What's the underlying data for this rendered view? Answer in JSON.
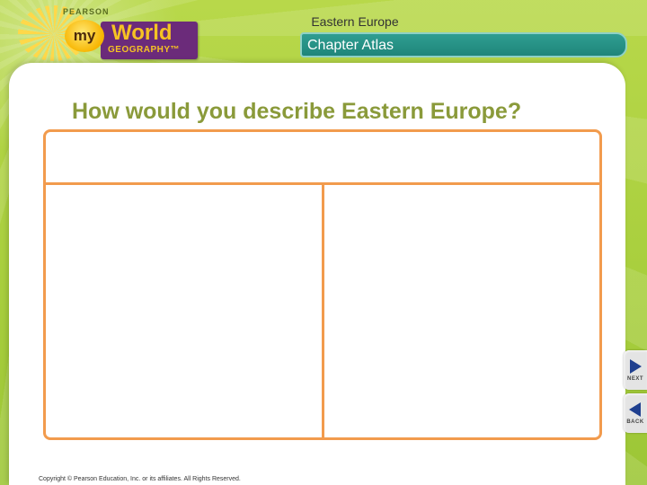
{
  "logo": {
    "publisher": "PEARSON",
    "my": "my",
    "world": "World",
    "subtitle": "GEOGRAPHY™"
  },
  "header": {
    "title": "Eastern Europe",
    "section": "Chapter Atlas"
  },
  "main": {
    "question": "How would you describe Eastern Europe?",
    "organizer": {
      "top": "",
      "left": "",
      "right": ""
    }
  },
  "nav": {
    "next_label": "NEXT",
    "back_label": "BACK"
  },
  "footer": {
    "copyright": "Copyright © Pearson Education, Inc. or its affiliates. All Rights Reserved."
  },
  "colors": {
    "background": "#a9cf3e",
    "header_bar": "#1f857a",
    "question_text": "#8a9a3a",
    "organizer_border": "#f29b4d",
    "logo_box": "#6b2b7a"
  }
}
